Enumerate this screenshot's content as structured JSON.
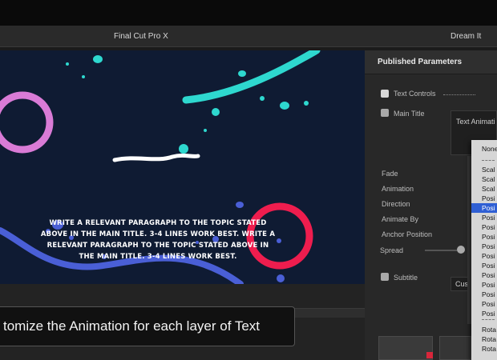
{
  "window": {
    "app_title": "Final Cut Pro X",
    "right_title": "Dream It"
  },
  "viewer": {
    "paragraph": "Write a relevant paragraph to the topic stated above in the main title. 3-4 lines work best. Write a relevant paragraph to the topic stated above in the main title. 3-4 lines work best.",
    "colors": {
      "background": "#0f1b33",
      "teal": "#2ed8cf",
      "blue": "#4a5fd6",
      "pink": "#d97bd6",
      "red": "#ee1d4e"
    }
  },
  "caption": {
    "text": "tomize the Animation for each layer of Text"
  },
  "panel": {
    "header": "Published Parameters",
    "text_controls": "Text Controls",
    "main_title": "Main Title",
    "text_animation_field": "Text Animati",
    "params": [
      "Fade",
      "Animation",
      "Direction",
      "Animate By",
      "Anchor Position",
      "Spread"
    ],
    "subtitle": "Subtitle",
    "cus_field": "Cus"
  },
  "dropdown": {
    "items_top": [
      "None"
    ],
    "items_mid": [
      "Scal",
      "Scal",
      "Scal",
      "Posi",
      "Posi",
      "Posi",
      "Posi",
      "Posi",
      "Posi",
      "Posi",
      "Posi",
      "Posi",
      "Posi",
      "Posi",
      "Posi",
      "Posi"
    ],
    "selected_index": 4,
    "items_bottom": [
      "Rota",
      "Rota",
      "Rota"
    ],
    "selected_color": "#2f5fd4"
  }
}
